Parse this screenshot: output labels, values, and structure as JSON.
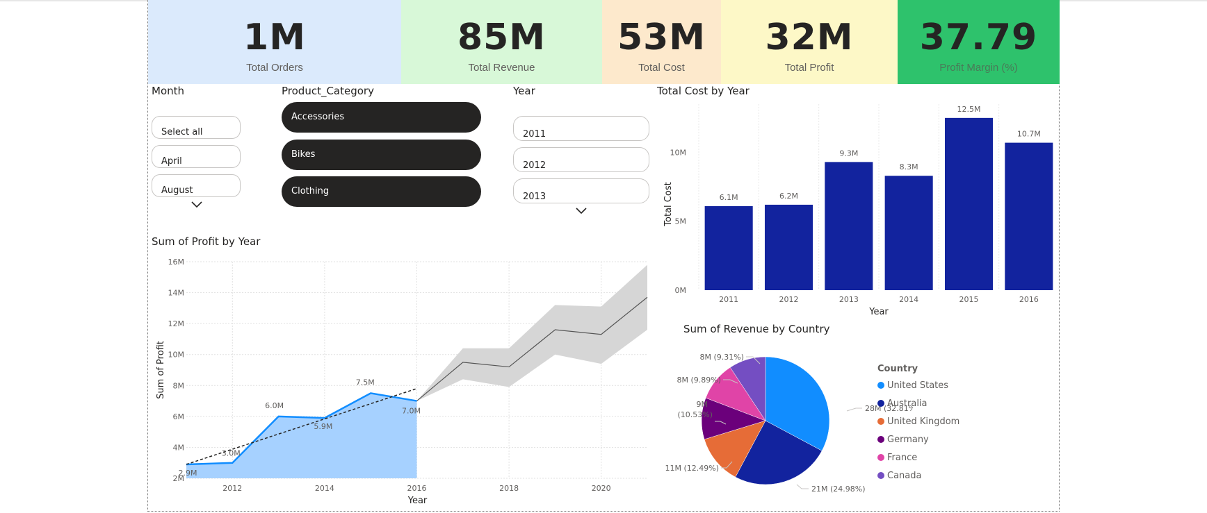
{
  "kpis": [
    {
      "value": "1M",
      "label": "Total Orders",
      "color": "#dbeafc"
    },
    {
      "value": "85M",
      "label": "Total Revenue",
      "color": "#d8f8d8"
    },
    {
      "value": "53M",
      "label": "Total Cost",
      "color": "#fde9cc"
    },
    {
      "value": "32M",
      "label": "Total Profit",
      "color": "#fdf8c7"
    },
    {
      "value": "37.79",
      "label": "Profit Margin (%)",
      "color": "#2ec26c"
    }
  ],
  "slicers": {
    "month": {
      "title": "Month",
      "items": [
        "Select all",
        "April",
        "August"
      ]
    },
    "category": {
      "title": "Product_Category",
      "items": [
        "Accessories",
        "Bikes",
        "Clothing"
      ]
    },
    "year": {
      "title": "Year",
      "items": [
        "2011",
        "2012",
        "2013"
      ]
    }
  },
  "profit_chart": {
    "title": "Sum of Profit by Year",
    "xlabel": "Year",
    "ylabel": "Sum of Profit",
    "yticks": [
      "16M",
      "14M",
      "12M",
      "10M",
      "8M",
      "6M",
      "4M",
      "2M"
    ],
    "xticks": [
      "2012",
      "2014",
      "2016",
      "2018",
      "2020"
    ]
  },
  "cost_chart": {
    "title": "Total Cost by Year",
    "xlabel": "Year",
    "ylabel": "Total Cost",
    "yticks": [
      "10M",
      "5M",
      "0M"
    ]
  },
  "revenue_chart": {
    "title": "Sum of Revenue by Country",
    "legend_title": "Country",
    "slice_labels": [
      "28M (32.81%)",
      "21M (24.98%)",
      "11M (12.49%)",
      "9M",
      "(10.53%)",
      "8M (9.89%)",
      "8M (9.31%)"
    ]
  },
  "chart_data": [
    {
      "type": "area",
      "title": "Sum of Profit by Year",
      "xlabel": "Year",
      "ylabel": "Sum of Profit",
      "x": [
        2011,
        2012,
        2013,
        2014,
        2015,
        2016
      ],
      "values": [
        2.9,
        3.0,
        6.0,
        5.9,
        7.5,
        7.0
      ],
      "value_labels": [
        "2.9M",
        "3.0M",
        "6.0M",
        "5.9M",
        "7.5M",
        "7.0M"
      ],
      "trend": {
        "x": [
          2011,
          2016
        ],
        "y": [
          2.9,
          7.8
        ]
      },
      "forecast": {
        "x": [
          2016,
          2017,
          2018,
          2019,
          2020,
          2021
        ],
        "y": [
          7.0,
          9.5,
          9.2,
          11.6,
          11.3,
          13.7
        ],
        "upper": [
          7.0,
          10.4,
          10.4,
          13.2,
          13.1,
          15.8
        ],
        "lower": [
          7.0,
          8.4,
          7.9,
          10.0,
          9.4,
          11.6
        ]
      },
      "ylim": [
        2,
        16
      ],
      "xlim": [
        2011,
        2021
      ],
      "unit": "M",
      "colors": {
        "line": "#118dff",
        "area": "#a6d1ff",
        "forecast": "#555555",
        "band": "#d6d6d6"
      }
    },
    {
      "type": "bar",
      "title": "Total Cost by Year",
      "xlabel": "Year",
      "ylabel": "Total Cost",
      "categories": [
        "2011",
        "2012",
        "2013",
        "2014",
        "2015",
        "2016"
      ],
      "values": [
        6.1,
        6.2,
        9.3,
        8.3,
        12.5,
        10.7
      ],
      "value_labels": [
        "6.1M",
        "6.2M",
        "9.3M",
        "8.3M",
        "12.5M",
        "10.7M"
      ],
      "ylim": [
        0,
        13.5
      ],
      "unit": "M",
      "color": "#12239e"
    },
    {
      "type": "pie",
      "title": "Sum of Revenue by Country",
      "legend_title": "Country",
      "labels": [
        "United States",
        "Australia",
        "United Kingdom",
        "Germany",
        "France",
        "Canada"
      ],
      "values": [
        28,
        21,
        11,
        9,
        8,
        8
      ],
      "percents": [
        32.81,
        24.98,
        12.49,
        10.53,
        9.89,
        9.31
      ],
      "colors": [
        "#118dff",
        "#12239e",
        "#e66c37",
        "#6b007b",
        "#e044a7",
        "#744ec2"
      ],
      "legend_position": "right"
    }
  ]
}
